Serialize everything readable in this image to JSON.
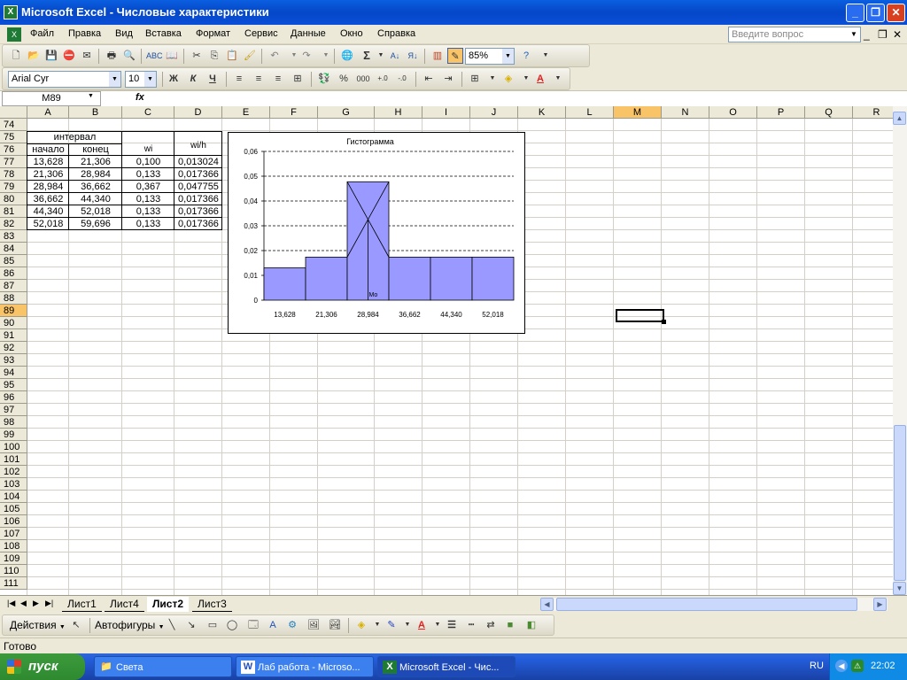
{
  "window": {
    "title": "Microsoft Excel - Числовые характеристики",
    "icon": "excel-icon",
    "minimize": "_",
    "restore": "❐",
    "close": "✕"
  },
  "menu": {
    "items": [
      "Файл",
      "Правка",
      "Вид",
      "Вставка",
      "Формат",
      "Сервис",
      "Данные",
      "Окно",
      "Справка"
    ],
    "ask_placeholder": "Введите вопрос",
    "doc_min": "_",
    "doc_restore": "❐",
    "doc_close": "✕"
  },
  "toolbar_std": {
    "zoom": "85%"
  },
  "toolbar_fmt": {
    "font": "Arial Cyr",
    "size": "10",
    "bold": "Ж",
    "italic": "К",
    "underline": "Ч",
    "percent": "%",
    "thousands": "000"
  },
  "formula": {
    "name_box": "M89",
    "fx": "fx",
    "content": ""
  },
  "columns": [
    "A",
    "B",
    "C",
    "D",
    "E",
    "F",
    "G",
    "H",
    "I",
    "J",
    "K",
    "L",
    "M",
    "N",
    "O",
    "P",
    "Q",
    "R"
  ],
  "selected_column": "M",
  "rows": [
    "74",
    "75",
    "76",
    "77",
    "78",
    "79",
    "80",
    "81",
    "82",
    "83",
    "84",
    "85",
    "86",
    "87",
    "88",
    "89",
    "90",
    "91",
    "92",
    "93",
    "94",
    "95",
    "96",
    "97",
    "98",
    "99",
    "100",
    "101",
    "102",
    "103",
    "104",
    "105",
    "106",
    "107",
    "108",
    "109",
    "110",
    "111"
  ],
  "selected_row": "89",
  "table": {
    "interval_header": "интервал",
    "start_header": "начало",
    "end_header": "конец",
    "wi_header": "wi",
    "wih_header": "wi/h",
    "data": [
      [
        "13,628",
        "21,306",
        "0,100",
        "0,013024"
      ],
      [
        "21,306",
        "28,984",
        "0,133",
        "0,017366"
      ],
      [
        "28,984",
        "36,662",
        "0,367",
        "0,047755"
      ],
      [
        "36,662",
        "44,340",
        "0,133",
        "0,017366"
      ],
      [
        "44,340",
        "52,018",
        "0,133",
        "0,017366"
      ],
      [
        "52,018",
        "59,696",
        "0,133",
        "0,017366"
      ]
    ]
  },
  "chart_data": {
    "type": "bar",
    "title": "Гистограмма",
    "categories": [
      "13,628",
      "21,306",
      "28,984",
      "36,662",
      "44,340",
      "52,018"
    ],
    "values": [
      0.013024,
      0.017366,
      0.047755,
      0.017366,
      0.017366,
      0.017366
    ],
    "ylim": [
      0,
      0.06
    ],
    "yticks": [
      "0",
      "0,01",
      "0,02",
      "0,03",
      "0,04",
      "0,05",
      "0,06"
    ],
    "grid": true,
    "bar_color": "#9999ff",
    "annotation": "Mo"
  },
  "sheets": {
    "tabs": [
      "Лист1",
      "Лист4",
      "Лист2",
      "Лист3"
    ],
    "active": "Лист2"
  },
  "drawing": {
    "actions": "Действия",
    "autoshapes": "Автофигуры"
  },
  "status": {
    "text": "Готово"
  },
  "taskbar": {
    "start": "пуск",
    "items": [
      {
        "label": "Света",
        "icon": "folder-icon"
      },
      {
        "label": "Лаб работа - Microso...",
        "icon": "word-icon"
      },
      {
        "label": "Microsoft Excel - Чис...",
        "icon": "excel-icon"
      }
    ],
    "lang": "RU",
    "time": "22:02"
  }
}
